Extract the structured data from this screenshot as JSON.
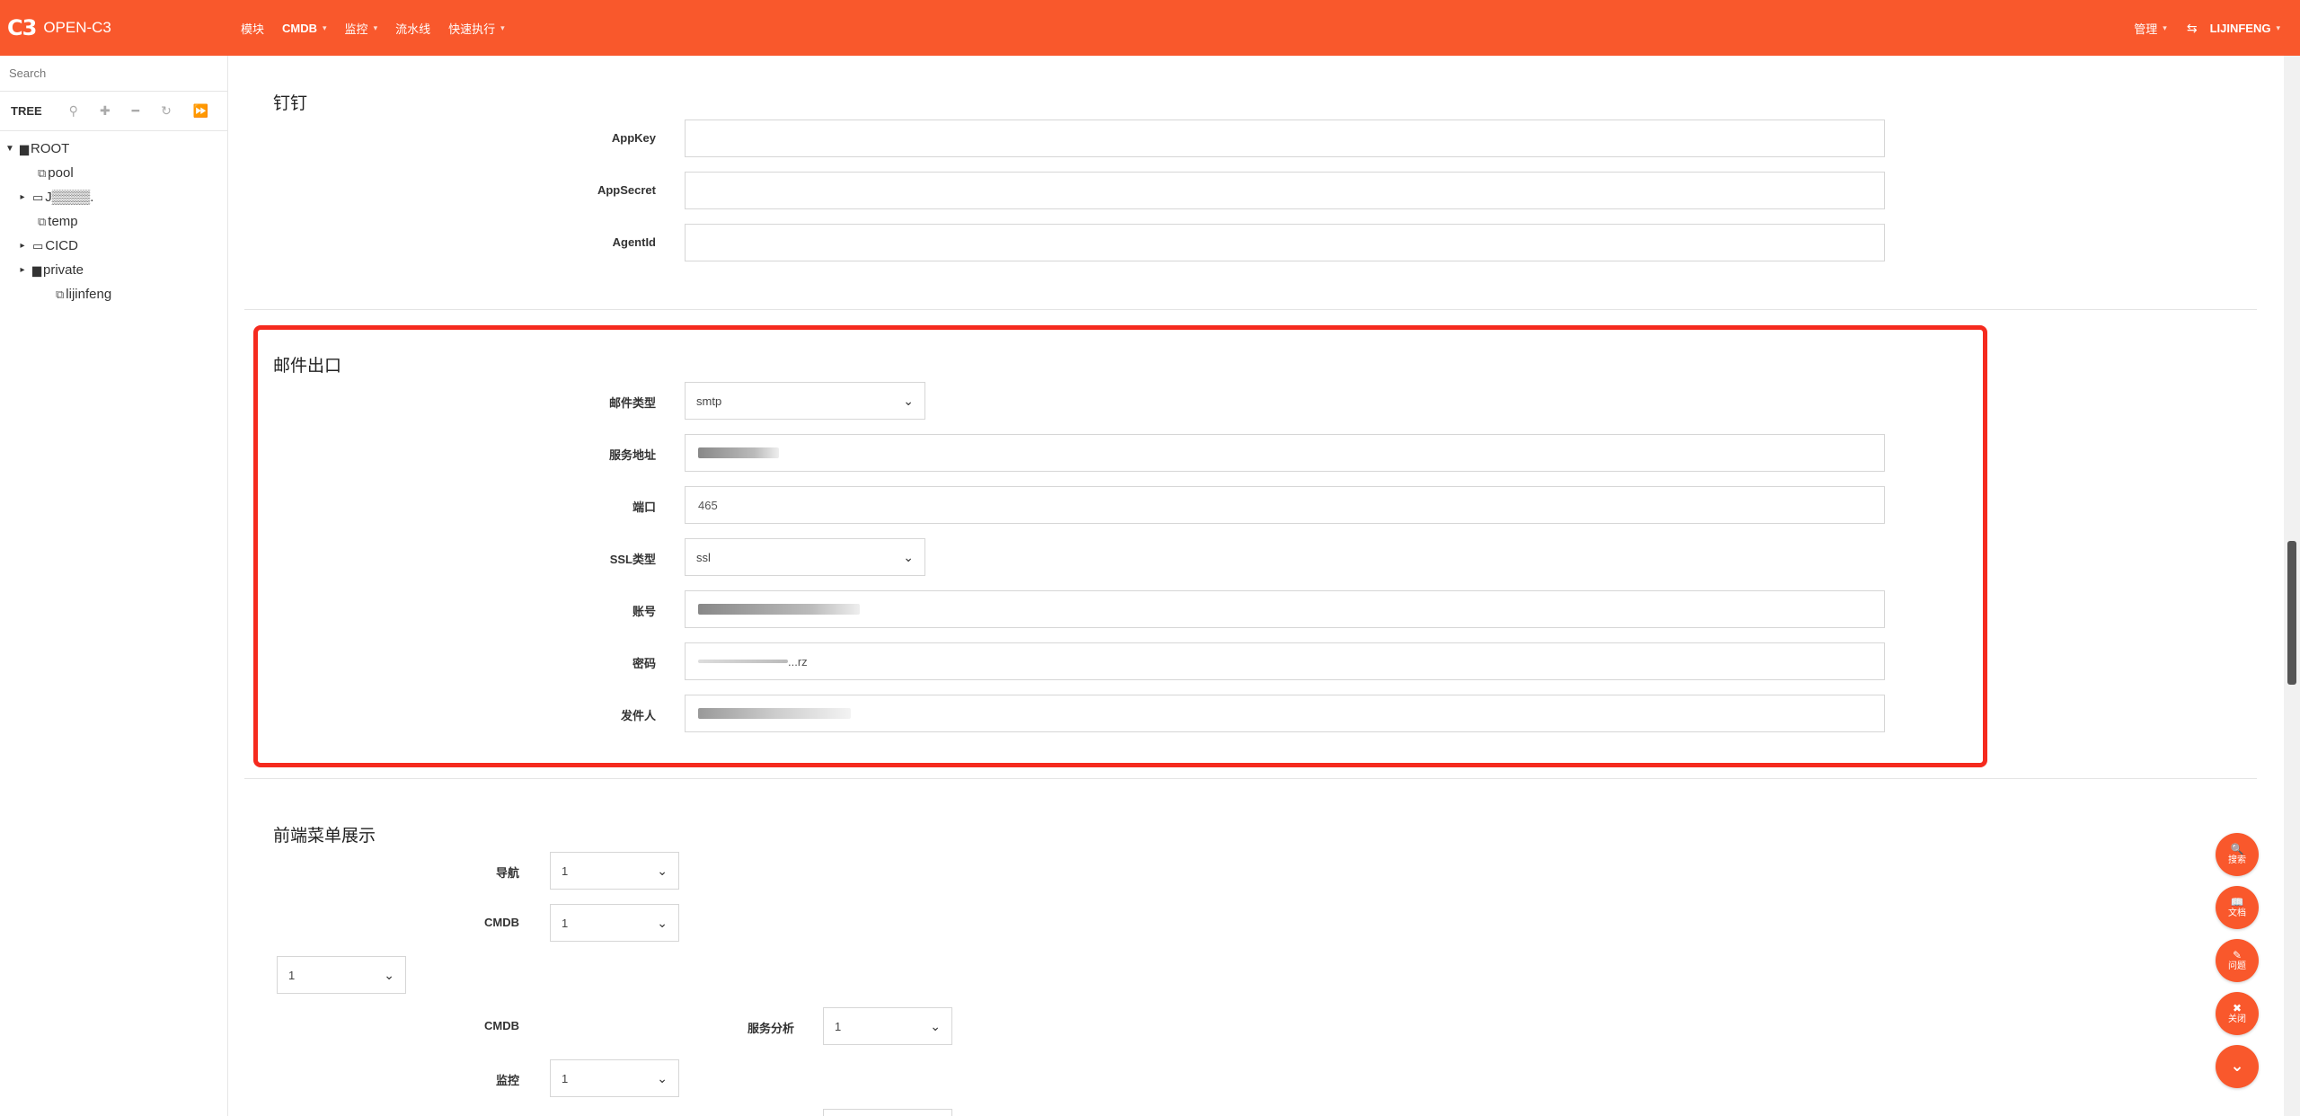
{
  "navbar": {
    "logo_text": "C3",
    "brand": "OPEN-C3",
    "menu": [
      {
        "label": "模块",
        "has_caret": false,
        "bold": false
      },
      {
        "label": "CMDB",
        "has_caret": true,
        "bold": true
      },
      {
        "label": "监控",
        "has_caret": true,
        "bold": false
      },
      {
        "label": "流水线",
        "has_caret": false,
        "bold": false
      },
      {
        "label": "快速执行",
        "has_caret": true,
        "bold": false
      }
    ],
    "admin_label": "管理",
    "user": "LIJINFENG",
    "accent_color": "#f9582c"
  },
  "sidebar": {
    "search_placeholder": "Search",
    "tree_label": "TREE",
    "tree": [
      {
        "label": "ROOT",
        "level": 0,
        "arrow": "expanded",
        "icon": "folder-solid"
      },
      {
        "label": "pool",
        "level": 1,
        "arrow": "none",
        "icon": "copy"
      },
      {
        "label": "J▒▒▒▒.",
        "level": 1,
        "arrow": "collapsed",
        "icon": "folder-outline"
      },
      {
        "label": "temp",
        "level": 1,
        "arrow": "none",
        "icon": "copy"
      },
      {
        "label": "CICD",
        "level": 1,
        "arrow": "collapsed",
        "icon": "folder-outline"
      },
      {
        "label": "private",
        "level": 1,
        "arrow": "collapsed",
        "icon": "folder-solid"
      },
      {
        "label": "lijinfeng",
        "level": 2,
        "arrow": "none",
        "icon": "copy"
      }
    ]
  },
  "dingding": {
    "title": "钉钉",
    "fields": [
      {
        "label": "AppKey",
        "value": ""
      },
      {
        "label": "AppSecret",
        "value": ""
      },
      {
        "label": "AgentId",
        "value": ""
      }
    ]
  },
  "mail": {
    "title": "邮件出口",
    "mail_type_label": "邮件类型",
    "mail_type_value": "smtp",
    "server_label": "服务地址",
    "port_label": "端口",
    "port_value": "465",
    "ssl_label": "SSL类型",
    "ssl_value": "ssl",
    "account_label": "账号",
    "password_label": "密码",
    "password_suffix": "...rz",
    "sender_label": "发件人",
    "highlight_color": "#f52a1e"
  },
  "frontend_menu": {
    "title": "前端菜单展示",
    "nav_label": "导航",
    "nav_value": "1",
    "cmdb_label": "CMDB",
    "cmdb_value": "1",
    "extra_select_value": "1",
    "cmdb2_label": "CMDB",
    "service_analysis_label": "服务分析",
    "service_analysis_value": "1",
    "monitor_label": "监控",
    "monitor_value": "1"
  },
  "floating_buttons": [
    {
      "icon": "search-icon",
      "glyph": "🔍",
      "label": "搜索"
    },
    {
      "icon": "book-icon",
      "glyph": "📖",
      "label": "文档"
    },
    {
      "icon": "edit-icon",
      "glyph": "✎",
      "label": "问题"
    },
    {
      "icon": "close-icon",
      "glyph": "✖",
      "label": "关闭"
    },
    {
      "icon": "double-chevron-down-icon",
      "glyph": "⌄",
      "label": ""
    }
  ]
}
